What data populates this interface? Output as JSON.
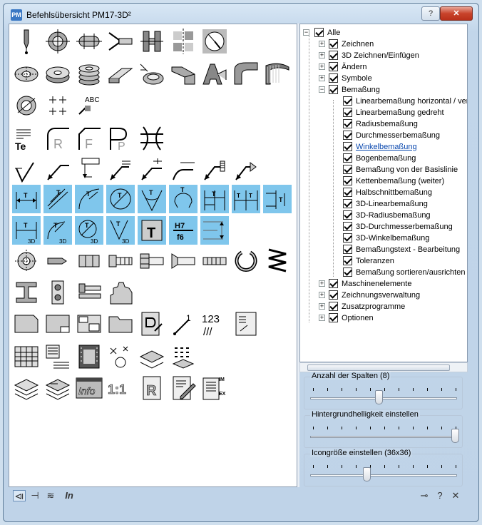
{
  "window": {
    "title": "Befehlsübersicht  PM17-3D²",
    "logo": "PM",
    "help_label": "?",
    "close_label": "✕"
  },
  "tree": {
    "root": "Alle",
    "groups": [
      {
        "label": "Zeichnen"
      },
      {
        "label": "3D Zeichnen/Einfügen"
      },
      {
        "label": "Ändern"
      },
      {
        "label": "Symbole"
      },
      {
        "label": "Bemaßung",
        "expanded": true
      }
    ],
    "bemassung_items": [
      "Linearbemaßung horizontal  / ver",
      "Linearbemaßung gedreht",
      "Radiusbemaßung",
      "Durchmesserbemaßung",
      "Winkelbemaßung",
      "Bogenbemaßung",
      "Bemaßung von der Basislinie",
      "Kettenbemaßung (weiter)",
      "Halbschnittbemaßung",
      "3D-Linearbemaßung",
      "3D-Radiusbemaßung",
      "3D-Durchmesserbemaßung",
      "3D-Winkelbemaßung",
      "Bemaßungstext - Bearbeitung",
      "Toleranzen",
      "Bemaßung sortieren/ausrichten"
    ],
    "selected_item": "Winkelbemaßung",
    "after_groups": [
      "Maschinenelemente",
      "Zeichnungsverwaltung",
      "Zusatzprogramme",
      "Optionen"
    ]
  },
  "settings": {
    "columns_label": "Anzahl der Spalten (8)",
    "columns_value": 8,
    "brightness_label": "Hintergrundhelligkeit einstellen",
    "brightness_fraction": 1.0,
    "iconsize_label": "Icongröße einstellen  (36x36)",
    "iconsize_fraction": 0.38
  },
  "icon_glyphs": {
    "abc": "ABC",
    "te": "Te",
    "r": "R",
    "f": "F",
    "p": "P",
    "t": "T",
    "h7": "H7",
    "f6": "f6",
    "numbers": "123",
    "slashes": "///",
    "info": "Info",
    "scale": "1:1",
    "im": "IM",
    "ex": "EX",
    "d3": "3D"
  },
  "bottom_bar": {
    "in_label": "In",
    "pin_label": "⊣",
    "help_label": "?",
    "close_label": "✕"
  }
}
